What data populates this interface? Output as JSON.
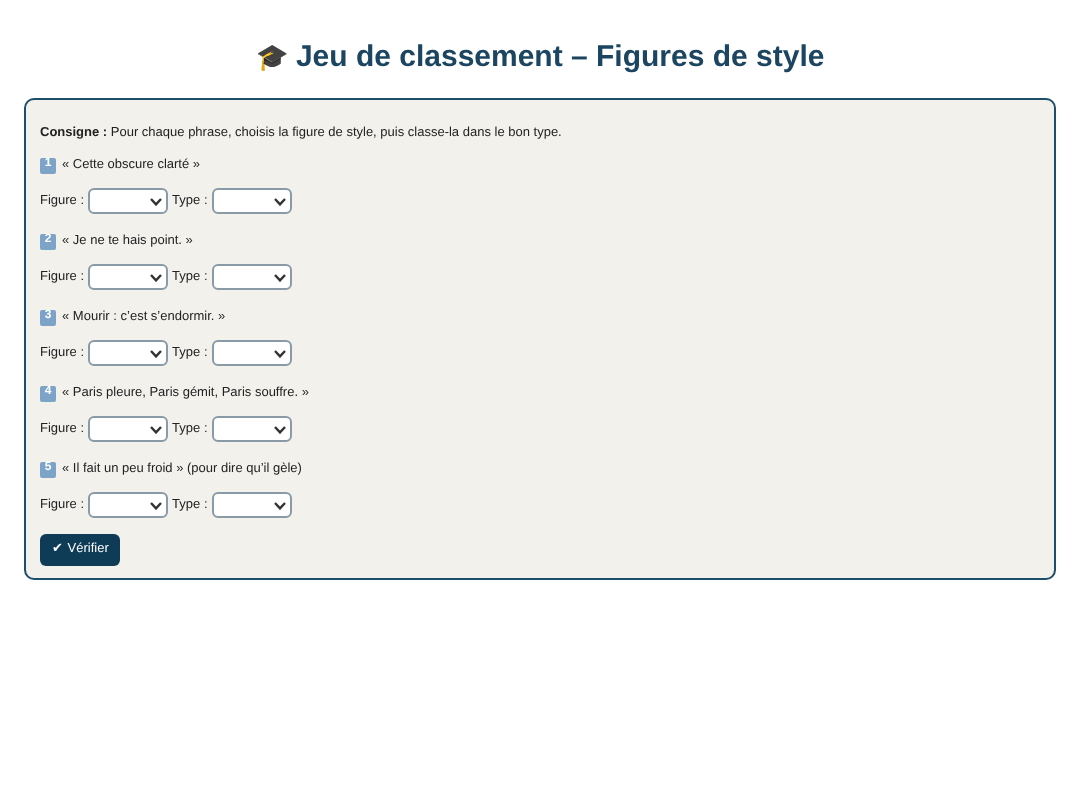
{
  "title": {
    "icon": "🎓",
    "text": "Jeu de classement – Figures de style"
  },
  "instruction": "**Consigne :** Pour chaque phrase, choisis la figure de style, puis classe-la dans le bon type.",
  "items": [
    {
      "number": "1",
      "sentence": "« Cette obscure clarté »",
      "figure_label": "Figure :",
      "type_label": "Type :"
    },
    {
      "number": "2",
      "sentence": "« Je ne te hais point. »",
      "figure_label": "Figure :",
      "type_label": "Type :"
    },
    {
      "number": "3",
      "sentence": "« Mourir : c’est s’endormir. »",
      "figure_label": "Figure :",
      "type_label": "Type :"
    },
    {
      "number": "4",
      "sentence": "« Paris pleure, Paris gémit, Paris souffre. »",
      "figure_label": "Figure :",
      "type_label": "Type :"
    },
    {
      "number": "5",
      "sentence": "« Il fait un peu froid » (pour dire qu’il gèle)",
      "figure_label": "Figure :",
      "type_label": "Type :"
    }
  ],
  "button": "✔ Vérifier"
}
